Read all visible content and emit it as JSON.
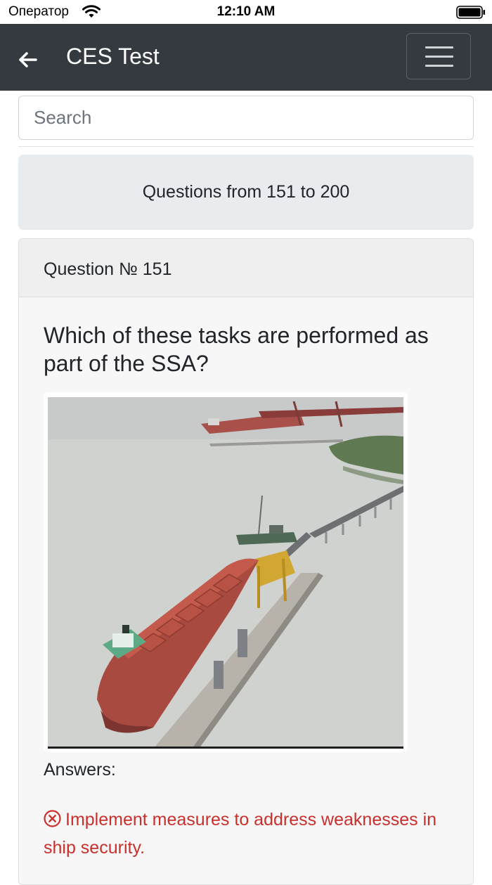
{
  "status_bar": {
    "carrier": "Оператор",
    "time": "12:10 AM"
  },
  "navbar": {
    "title": "CES Test",
    "back_icon": "arrow-left-icon",
    "menu_icon": "hamburger-icon"
  },
  "search": {
    "placeholder": "Search",
    "value": ""
  },
  "range": {
    "label": "Questions from 151 to 200"
  },
  "question": {
    "number_label": "Question № 151",
    "text": "Which of these tasks are performed as part of the SSA?",
    "image_icon": "bulk-carrier-at-pier-photo"
  },
  "answers": {
    "label": "Answers:",
    "items": [
      {
        "text": "Implement measures to address weaknesses in ship security.",
        "status": "incorrect",
        "icon": "x-circle-icon"
      }
    ]
  },
  "colors": {
    "navbar_bg": "#343a40",
    "incorrect": "#c9302c",
    "range_bg": "#e9ecef"
  }
}
